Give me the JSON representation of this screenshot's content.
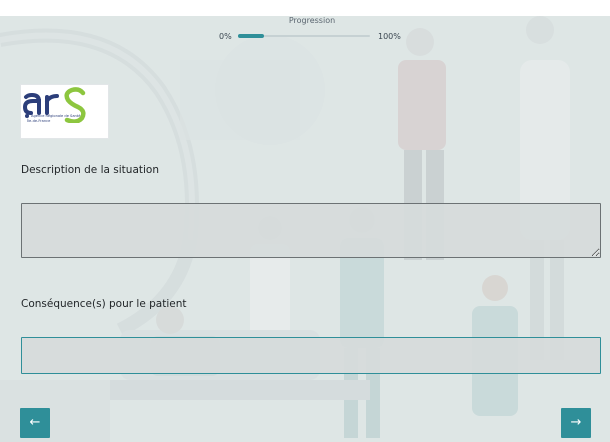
{
  "progress": {
    "title": "Progression",
    "start_label": "0%",
    "end_label": "100%",
    "value": 0.2
  },
  "logo": {
    "sub_line1": "Agence Régionale de Santé",
    "sub_line2": "Île-de-France"
  },
  "form": {
    "description_label": "Description de la situation",
    "description_value": "",
    "consequence_label": "Conséquence(s) pour le patient",
    "consequence_value": ""
  },
  "nav": {
    "prev_icon": "arrow-left-icon",
    "prev_glyph": "←",
    "next_icon": "arrow-right-icon",
    "next_glyph": "→"
  },
  "colors": {
    "accent": "#2f8f99",
    "logo_blue": "#2c3e7a",
    "logo_green": "#8dc63f"
  }
}
